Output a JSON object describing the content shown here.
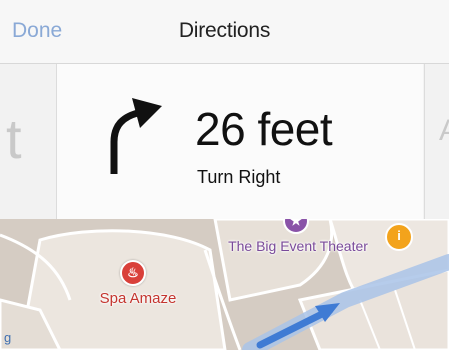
{
  "navbar": {
    "left_button": "Done",
    "title": "Directions"
  },
  "directions": {
    "current": {
      "distance": "26 feet",
      "instruction": "Turn Right",
      "icon": "turn-right-arrow-icon"
    },
    "previous_peek": "t",
    "next_peek": "A"
  },
  "map": {
    "places": [
      {
        "name": "Spa Amaze",
        "icon": "spa-icon",
        "color": "#d9403a"
      },
      {
        "name": "The Big Event Theater",
        "icon": "theater-icon",
        "color": "#8a53a8"
      },
      {
        "name": "",
        "icon": "info-icon",
        "color": "#f3a31c"
      }
    ],
    "edge_label": "g",
    "route_color": "#4a86d8"
  },
  "colors": {
    "accent": "#8aa9d6",
    "navbar_bg": "#f7f7f7",
    "map_bg": "#d8cfc7"
  }
}
